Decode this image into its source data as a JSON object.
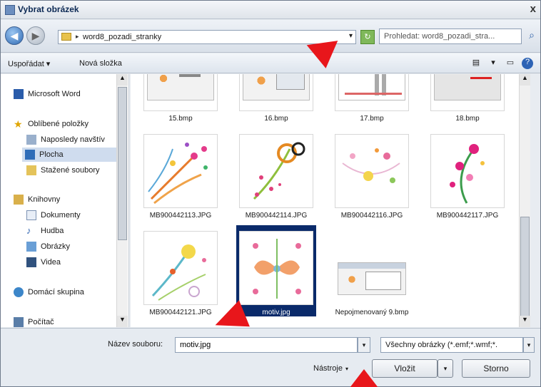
{
  "window": {
    "title": "Vybrat obrázek",
    "close_symbol": "x"
  },
  "address": {
    "path_arrow": "▸",
    "path": "word8_pozadi_stranky",
    "dropdown": "▾",
    "search_placeholder": "Prohledat: word8_pozadi_stra...",
    "search_symbol": "⌕",
    "refresh_symbol": "↻",
    "back_symbol": "◀",
    "forward_symbol": "▶"
  },
  "toolbar": {
    "organize": "Uspořádat ▾",
    "new_folder": "Nová složka",
    "views_symbol": "▤",
    "views_dd": "▾",
    "pane_symbol": "▭",
    "help_symbol": "?"
  },
  "sidebar": {
    "items": [
      {
        "label": "Microsoft Word",
        "icon": "word-icon"
      },
      {
        "label": "Oblíbené položky",
        "icon": "star-icon"
      },
      {
        "label": "Naposledy navštív",
        "icon": "recent-places-icon"
      },
      {
        "label": "Plocha",
        "icon": "desktop-icon"
      },
      {
        "label": "Stažené soubory",
        "icon": "downloads-icon"
      },
      {
        "label": "Knihovny",
        "icon": "libraries-icon"
      },
      {
        "label": "Dokumenty",
        "icon": "documents-icon"
      },
      {
        "label": "Hudba",
        "icon": "music-icon"
      },
      {
        "label": "Obrázky",
        "icon": "pictures-icon"
      },
      {
        "label": "Videa",
        "icon": "videos-icon"
      },
      {
        "label": "Domácí skupina",
        "icon": "homegroup-icon"
      },
      {
        "label": "Počítač",
        "icon": "computer-icon"
      }
    ]
  },
  "files": [
    {
      "name": "15.bmp",
      "kind": "screenshot"
    },
    {
      "name": "16.bmp",
      "kind": "screenshot"
    },
    {
      "name": "17.bmp",
      "kind": "screenshot"
    },
    {
      "name": "18.bmp",
      "kind": "screenshot"
    },
    {
      "name": "MB900442113.JPG",
      "kind": "floral"
    },
    {
      "name": "MB900442114.JPG",
      "kind": "floral"
    },
    {
      "name": "MB900442116.JPG",
      "kind": "floral"
    },
    {
      "name": "MB900442117.JPG",
      "kind": "floral"
    },
    {
      "name": "MB900442121.JPG",
      "kind": "floral"
    },
    {
      "name": "motiv.jpg",
      "kind": "floral",
      "selected": true
    },
    {
      "name": "Nepojmenovaný 9.bmp",
      "kind": "screenshot"
    }
  ],
  "bottom": {
    "filename_label": "Název souboru:",
    "filename_value": "motiv.jpg",
    "filter_value": "Všechny obrázky (*.emf;*.wmf;*.",
    "tools": "Nástroje",
    "tools_dd": "▾",
    "insert": "Vložit",
    "insert_dd": "▾",
    "cancel": "Storno",
    "dd_symbol": "▾"
  },
  "scroll": {
    "up": "▲",
    "down": "▼"
  },
  "colors": {
    "selection": "#0a2a6a",
    "annotation_arrow": "#e8161b"
  }
}
